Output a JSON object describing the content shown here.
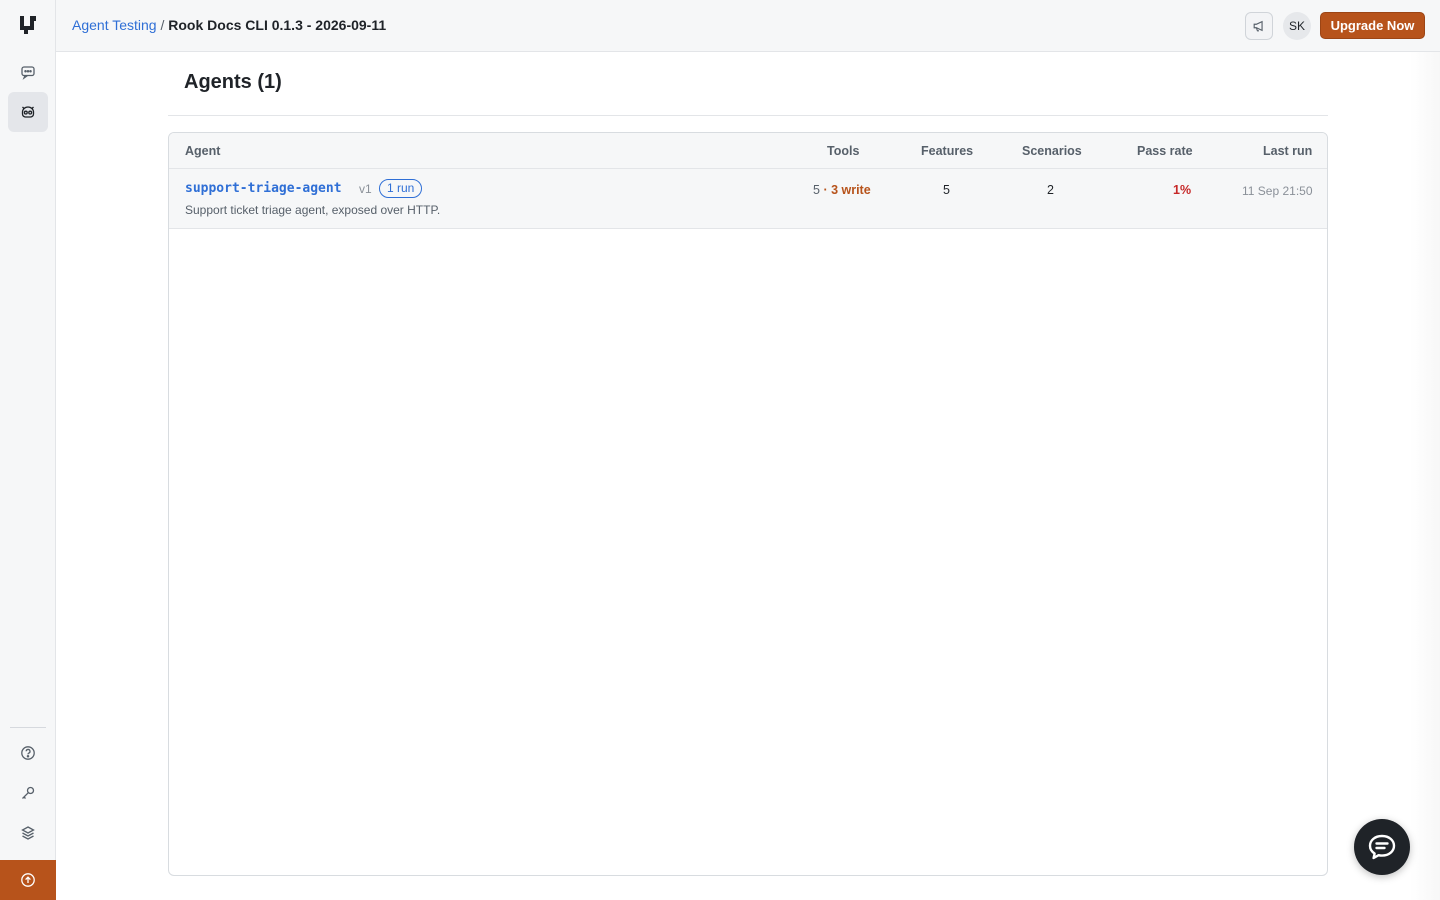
{
  "header": {
    "breadcrumb_parent": "Agent Testing",
    "breadcrumb_separator": " / ",
    "breadcrumb_current": "Rook Docs CLI 0.1.3 - 2026-09-11",
    "avatar_initials": "SK",
    "upgrade_label": "Upgrade Now"
  },
  "sidebar": {
    "items": [
      {
        "icon": "chat-icon",
        "active": false
      },
      {
        "icon": "agent-testing-icon",
        "active": true
      }
    ],
    "bottom_items": [
      {
        "icon": "help-icon"
      },
      {
        "icon": "key-icon"
      },
      {
        "icon": "layers-icon"
      },
      {
        "icon": "upgrade-arrow-icon"
      }
    ]
  },
  "main": {
    "title": "Agents (1)",
    "columns": {
      "agent": "Agent",
      "tools": "Tools",
      "features": "Features",
      "scenarios": "Scenarios",
      "pass_rate": "Pass rate",
      "last_run": "Last run"
    },
    "rows": [
      {
        "name": "support-triage-agent",
        "version": "v1",
        "runs": "1 run",
        "description": "Support ticket triage agent, exposed over HTTP.",
        "tools_count": "5",
        "tools_write": "· 3 write",
        "features": "5",
        "scenarios": "2",
        "pass_rate": "1%",
        "last_run": "11 Sep 21:50"
      }
    ]
  },
  "colors": {
    "accent": "#b7531b",
    "link": "#2f6fd6",
    "fail": "#c62828"
  }
}
